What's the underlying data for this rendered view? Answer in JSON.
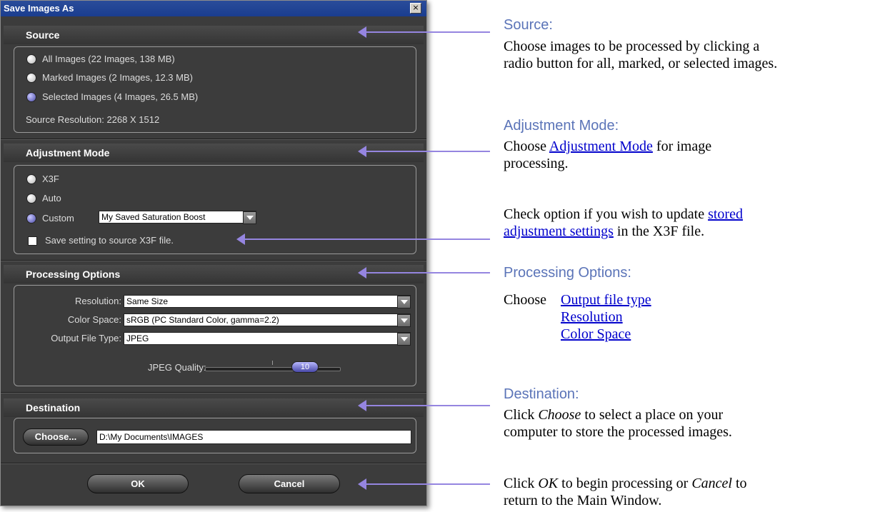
{
  "dialog": {
    "title": "Save Images As",
    "close_glyph": "×",
    "source": {
      "heading": "Source",
      "options": [
        {
          "label": "All Images  (22 Images, 138 MB)",
          "selected": false
        },
        {
          "label": "Marked Images  (2 Images, 12.3 MB)",
          "selected": false
        },
        {
          "label": "Selected Images  (4 Images, 26.5 MB)",
          "selected": true
        }
      ],
      "resolution_text": "Source Resolution:  2268 X 1512"
    },
    "adjustment": {
      "heading": "Adjustment Mode",
      "options": [
        {
          "label": "X3F",
          "selected": false
        },
        {
          "label": "Auto",
          "selected": false
        },
        {
          "label": "Custom",
          "selected": true
        }
      ],
      "custom_value": "My Saved Saturation Boost",
      "save_checkbox_label": "Save setting to source X3F file.",
      "save_checked": false
    },
    "processing": {
      "heading": "Processing Options",
      "resolution_label": "Resolution:",
      "resolution_value": "Same Size",
      "color_space_label": "Color Space:",
      "color_space_value": "sRGB (PC Standard Color, gamma=2.2)",
      "file_type_label": "Output File Type:",
      "file_type_value": "JPEG",
      "jpeg_quality_label": "JPEG Quality:",
      "jpeg_quality_value": "10"
    },
    "destination": {
      "heading": "Destination",
      "choose_label": "Choose...",
      "path": "D:\\My Documents\\IMAGES"
    },
    "ok_label": "OK",
    "cancel_label": "Cancel"
  },
  "annotations": {
    "source": {
      "heading": "Source:",
      "line1": "Choose images to be processed by clicking a",
      "line2": "radio button for all, marked, or selected images."
    },
    "adjustment": {
      "heading": "Adjustment Mode:",
      "line1_pre": "Choose ",
      "line1_link": "Adjustment Mode",
      "line1_post": " for image",
      "line2": "processing."
    },
    "stored": {
      "line1_pre": "Check option if you wish to update ",
      "line1_link": "stored",
      "line2_link": "adjustment settings",
      "line2_post": " in the X3F file."
    },
    "processing": {
      "heading": "Processing Options:",
      "choose": "Choose",
      "links": [
        "Output file type",
        "Resolution",
        "Color Space"
      ]
    },
    "destination": {
      "heading": "Destination:",
      "line1_pre": "Click ",
      "line1_em": "Choose",
      "line1_post": " to select a place on your",
      "line2": "computer to store the processed images."
    },
    "ok_cancel": {
      "line1_pre": "Click ",
      "line1_em1": "OK",
      "line1_mid": " to begin processing or ",
      "line1_em2": "Cancel",
      "line1_post": " to",
      "line2": "return to the Main Window."
    }
  },
  "colors": {
    "annotation_arrow": "#9585e0",
    "annotation_heading": "#5b74b8",
    "link": "#0000cc",
    "dialog_bg": "#3c3c3c",
    "titlebar": "#1a3d8f"
  }
}
